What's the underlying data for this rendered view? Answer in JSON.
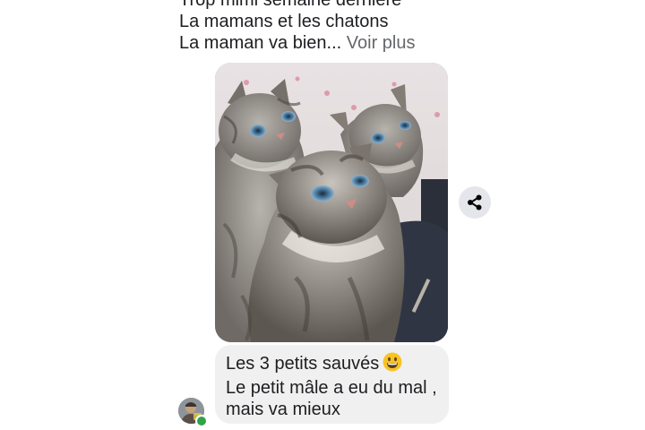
{
  "previous_message": {
    "lines": [
      "Trop mimi semaine dernière",
      "La mamans et les chatons"
    ],
    "last_line": "La maman va bien...",
    "see_more_label": "Voir plus"
  },
  "photo": {
    "subject": "three kittens photo"
  },
  "share_button": {
    "icon": "share-icon"
  },
  "message": {
    "lines": [
      "Les 3 petits sauvés",
      "Le petit mâle a eu du mal ,",
      "mais va mieux"
    ],
    "emoji": "grinning-face-emoji"
  },
  "sender": {
    "online": true,
    "online_color": "#31a24c"
  },
  "colors": {
    "bubble_background": "#f0f0f0",
    "text": "#1c1e21",
    "secondary_text": "#65676b",
    "share_button_background": "#e4e6eb"
  }
}
